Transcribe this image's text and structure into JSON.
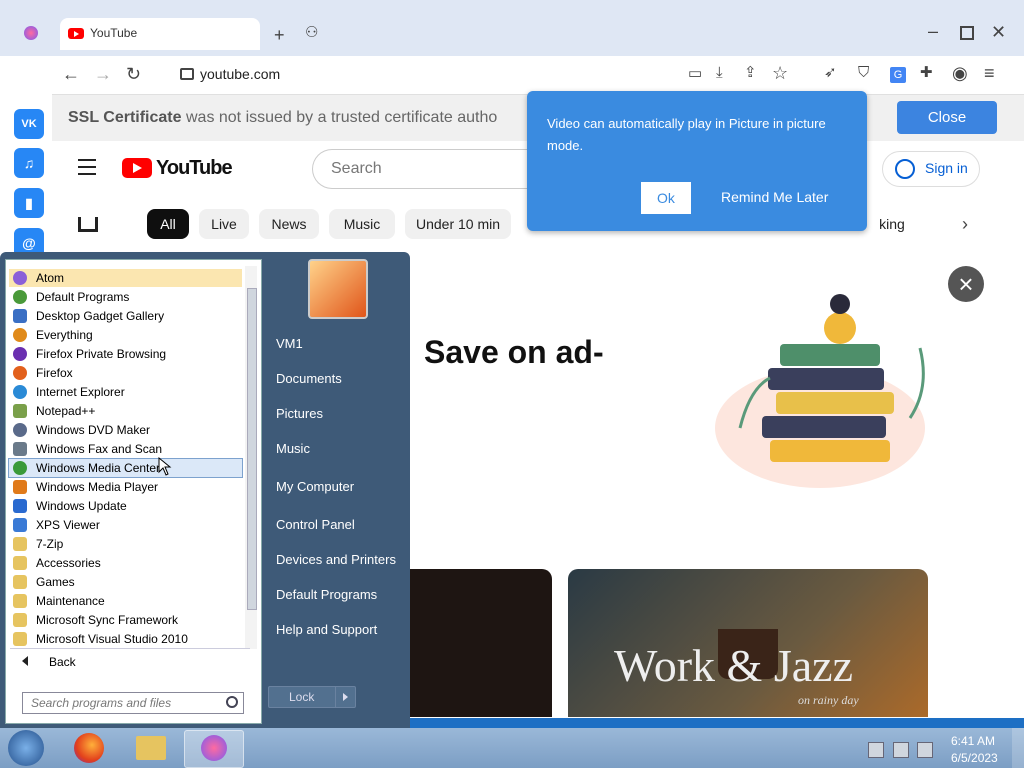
{
  "browser": {
    "tab_title": "YouTube",
    "url": "youtube.com"
  },
  "ssl_bar": {
    "bold": "SSL Certificate",
    "text": "was not issued by a trusted certificate autho",
    "close_label": "Close"
  },
  "youtube": {
    "wordmark": "YouTube",
    "search_placeholder": "Search",
    "signin": "Sign in",
    "chips": [
      "All",
      "Live",
      "News",
      "Music",
      "Under 10 min",
      "king"
    ]
  },
  "pip_popup": {
    "message": "Video can automatically play in Picture in picture mode.",
    "ok": "Ok",
    "later": "Remind Me Later"
  },
  "ad": {
    "heading": "Save on ad-",
    "thumb_title": "Work & Jazz",
    "thumb_subtitle": "on rainy day"
  },
  "start_menu": {
    "programs": [
      {
        "label": "Atom",
        "color": "#8b5fd8"
      },
      {
        "label": "Default Programs",
        "color": "#4a9a3a"
      },
      {
        "label": "Desktop Gadget Gallery",
        "color": "#3a6fc4"
      },
      {
        "label": "Everything",
        "color": "#e08a1a"
      },
      {
        "label": "Firefox Private Browsing",
        "color": "#6a2fb0"
      },
      {
        "label": "Firefox",
        "color": "#e2601c"
      },
      {
        "label": "Internet Explorer",
        "color": "#2a8ad6"
      },
      {
        "label": "Notepad++",
        "color": "#7aa04a"
      },
      {
        "label": "Windows DVD Maker",
        "color": "#5a6a8a"
      },
      {
        "label": "Windows Fax and Scan",
        "color": "#6a7a8a"
      },
      {
        "label": "Windows Media Center",
        "color": "#3a9a3a"
      },
      {
        "label": "Windows Media Player",
        "color": "#e07a1a"
      },
      {
        "label": "Windows Update",
        "color": "#2a6ad0"
      },
      {
        "label": "XPS Viewer",
        "color": "#3a7ad6"
      },
      {
        "label": "7-Zip",
        "color": "#e6c460"
      },
      {
        "label": "Accessories",
        "color": "#e6c460"
      },
      {
        "label": "Games",
        "color": "#e6c460"
      },
      {
        "label": "Maintenance",
        "color": "#e6c460"
      },
      {
        "label": "Microsoft Sync Framework",
        "color": "#e6c460"
      },
      {
        "label": "Microsoft Visual Studio 2010",
        "color": "#e6c460"
      }
    ],
    "back": "Back",
    "search_placeholder": "Search programs and files",
    "right_links": [
      "VM1",
      "Documents",
      "Pictures",
      "Music",
      "My Computer",
      "Control Panel",
      "Devices and Printers",
      "Default Programs",
      "Help and Support"
    ],
    "lock": "Lock"
  },
  "taskbar": {
    "time": "6:41 AM",
    "date": "6/5/2023"
  }
}
